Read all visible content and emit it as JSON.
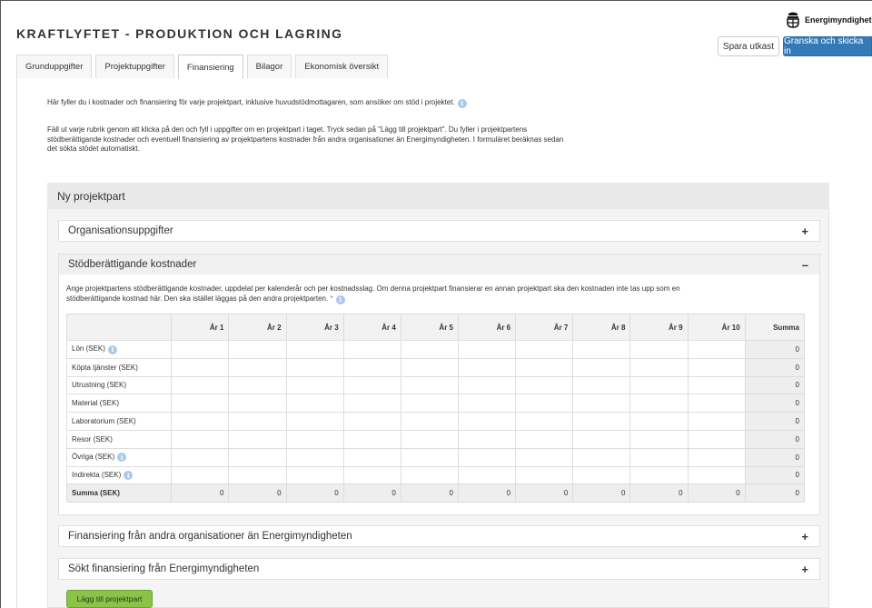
{
  "app": {
    "title": "KRAFTLYFTET - PRODUKTION OCH LAGRING",
    "logo_text": "Energimyndigheten"
  },
  "toolbar": {
    "save_draft": "Spara utkast",
    "review_submit": "Granska och skicka in"
  },
  "tabs": [
    {
      "label": "Grunduppgifter",
      "active": false
    },
    {
      "label": "Projektuppgifter",
      "active": false
    },
    {
      "label": "Finansiering",
      "active": true
    },
    {
      "label": "Bilagor",
      "active": false
    },
    {
      "label": "Ekonomisk översikt",
      "active": false
    }
  ],
  "intro": {
    "p1": "Här fyller du i kostnader och finansiering för varje projektpart, inklusive huvudstödmottagaren, som ansöker om stöd i projektet.",
    "p2": "Fäll ut varje rubrik genom att klicka på den och fyll i uppgifter om en projektpart i taget. Tryck sedan på \"Lägg till projektpart\". Du fyller i projektpartens stödberättigande kostnader och eventuell finansiering av projektpartens kostnader från andra organisationer än Energimyndigheten. I formuläret beräknas sedan det sökta stödet automatiskt."
  },
  "panel": {
    "title": "Ny projektpart",
    "sections": {
      "org": {
        "title": "Organisationsuppgifter",
        "toggle": "+"
      },
      "costs": {
        "title": "Stödberättigande kostnader",
        "toggle": "–",
        "description": "Ange projektpartens stödberättigande kostnader, uppdelat per kalenderår och per kostnadsslag. Om denna projektpart finansierar en annan projektpart ska den kostnaden inte tas upp som en stödberättigande kostnad här. Den ska istället läggas på den andra projektparten.",
        "required_mark": "*"
      },
      "other_fin": {
        "title": "Finansiering från andra organisationer än Energimyndigheten",
        "toggle": "+"
      },
      "requested": {
        "title": "Sökt finansiering från Energimyndigheten",
        "toggle": "+"
      }
    },
    "add_button": "Lägg till projektpart"
  },
  "table": {
    "columns": [
      "",
      "År 1",
      "År 2",
      "År 3",
      "År 4",
      "År 5",
      "År 6",
      "År 7",
      "År 8",
      "År 9",
      "År 10",
      "Summa"
    ],
    "rows": [
      {
        "label": "Lön (SEK)",
        "info": true,
        "sum": "0"
      },
      {
        "label": "Köpta tjänster (SEK)",
        "info": false,
        "sum": "0"
      },
      {
        "label": "Utrustning (SEK)",
        "info": false,
        "sum": "0"
      },
      {
        "label": "Material (SEK)",
        "info": false,
        "sum": "0"
      },
      {
        "label": "Laboratorium (SEK)",
        "info": false,
        "sum": "0"
      },
      {
        "label": "Resor (SEK)",
        "info": false,
        "sum": "0"
      },
      {
        "label": "Övriga (SEK)",
        "info": true,
        "sum": "0"
      },
      {
        "label": "Indirekta (SEK)",
        "info": true,
        "sum": "0"
      }
    ],
    "total": {
      "label": "Summa (SEK)",
      "values": [
        "0",
        "0",
        "0",
        "0",
        "0",
        "0",
        "0",
        "0",
        "0",
        "0",
        "0"
      ]
    }
  }
}
